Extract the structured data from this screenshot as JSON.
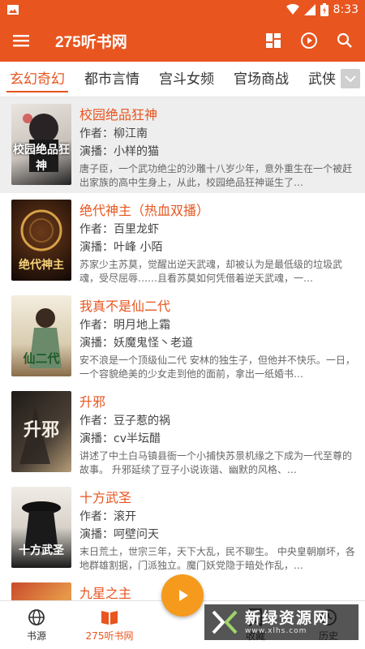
{
  "status_bar": {
    "time": "8:33"
  },
  "app_bar": {
    "title": "275听书网"
  },
  "tabs": [
    {
      "label": "玄幻奇幻",
      "active": true
    },
    {
      "label": "都市言情"
    },
    {
      "label": "宫斗女频"
    },
    {
      "label": "官场商战"
    },
    {
      "label": "武侠"
    }
  ],
  "books": [
    {
      "title": "校园绝品狂神",
      "author": "作者：柳江南",
      "narrator": "演播：小样的猫",
      "desc": "唐子臣，一个武功绝尘的沙雕十八岁少年，意外重生在一个被赶出家族的高中生身上，从此，校园绝品狂神诞生了…",
      "cover_text": "校园绝品狂神",
      "cover_colors": [
        "#e9e3dc",
        "#1c1c1c"
      ]
    },
    {
      "title": "绝代神主（热血双播）",
      "author": "作者：百里龙虾",
      "narrator": "演播：叶峰 小陌",
      "desc": "苏家少主苏莫，觉醒出逆天武魂，却被认为是最低级的垃圾武魂，受尽屈辱……且看苏莫如何凭借着逆天武魂，一…",
      "cover_text": "绝代神主",
      "cover_colors": [
        "#3a1e10",
        "#d9a04a"
      ]
    },
    {
      "title": "我真不是仙二代",
      "author": "作者：明月地上霜",
      "narrator": "演播：妖魔鬼怪丶老道",
      "desc": "安不浪是一个顶级仙二代 安林的独生子，但他并不快乐。一日，一个容貌绝美的少女走到他的面前，拿出一纸婚书…",
      "cover_text": "仙二代",
      "cover_colors": [
        "#f1ead8",
        "#2e6a3a"
      ]
    },
    {
      "title": "升邪",
      "author": "作者：豆子惹的祸",
      "narrator": "演播：cv半坛醋",
      "desc": "讲述了中土白马镇县衙一个小捕快苏景机缘之下成为一代至尊的故事。 升邪延续了豆子小说诙谐、幽默的风格、…",
      "cover_text": "升邪",
      "cover_colors": [
        "#2a2520",
        "#c8b89a"
      ]
    },
    {
      "title": "十方武圣",
      "author": "作者：滚开",
      "narrator": "演播：呵壁问天",
      "desc": "末日荒土，世宗三年，天下大乱，民不聊生。 中央皇朝崩坏，各地群雄割据，门派独立。魔门妖党隐于暗处作乱，…",
      "cover_text": "十方武圣",
      "cover_colors": [
        "#e8e4de",
        "#151515"
      ]
    },
    {
      "title": "九星之主",
      "author": "",
      "narrator": "",
      "desc": "",
      "cover_text": "",
      "cover_colors": [
        "#c94a2a",
        "#3d6fb0"
      ]
    }
  ],
  "bottom_nav": [
    {
      "label": "书源",
      "icon": "globe-icon"
    },
    {
      "label": "275听书网",
      "icon": "book-icon",
      "active": true
    },
    {
      "label": "",
      "icon": "play-icon"
    },
    {
      "label": "收藏",
      "icon": "bookmark-icon"
    },
    {
      "label": "历史",
      "icon": "history-icon"
    }
  ],
  "watermark": {
    "title": "新绿资源网",
    "url": "www.xlhs.com"
  },
  "colors": {
    "accent": "#e8551f",
    "fab": "#f59a1c"
  }
}
